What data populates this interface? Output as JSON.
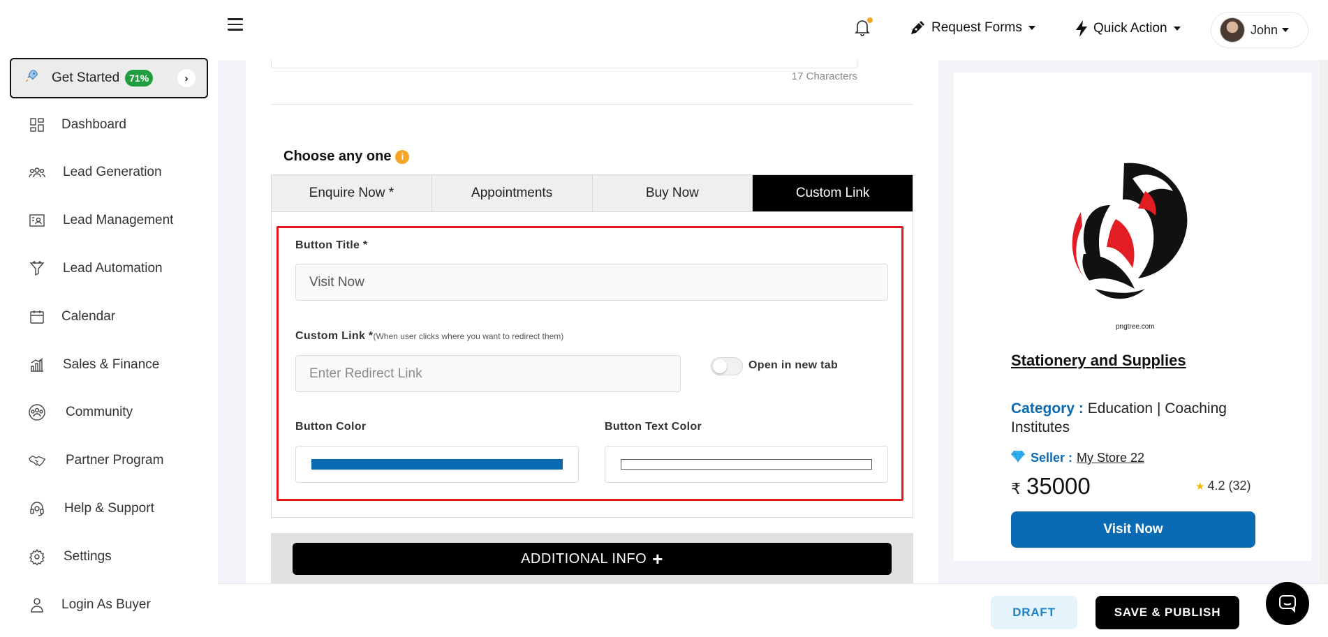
{
  "header": {
    "request_forms": "Request Forms",
    "quick_action": "Quick Action",
    "user_name": "John"
  },
  "sidebar": {
    "get_started": {
      "label": "Get Started",
      "progress": "71%"
    },
    "items": [
      {
        "label": "Dashboard",
        "icon": "dashboard-icon"
      },
      {
        "label": "Lead Generation",
        "icon": "users-icon"
      },
      {
        "label": "Lead Management",
        "icon": "contact-card-icon"
      },
      {
        "label": "Lead Automation",
        "icon": "funnel-icon"
      },
      {
        "label": "Calendar",
        "icon": "calendar-icon"
      },
      {
        "label": "Sales & Finance",
        "icon": "bar-chart-icon"
      },
      {
        "label": "Community",
        "icon": "community-icon"
      },
      {
        "label": "Partner Program",
        "icon": "handshake-icon"
      },
      {
        "label": "Help & Support",
        "icon": "headset-icon"
      },
      {
        "label": "Settings",
        "icon": "gear-icon"
      },
      {
        "label": "Login As Buyer",
        "icon": "person-icon"
      }
    ]
  },
  "form": {
    "char_count": "17 Characters",
    "choose_title": "Choose any one",
    "tabs": [
      "Enquire Now *",
      "Appointments",
      "Buy Now",
      "Custom Link"
    ],
    "active_tab": "Custom Link",
    "button_title_label": "Button Title *",
    "button_title_value": "Visit Now",
    "custom_link_label": "Custom Link *",
    "custom_link_hint": "(When user clicks where you want to redirect them)",
    "custom_link_placeholder": "Enter Redirect Link",
    "open_new_tab_label": "Open in new tab",
    "open_new_tab_on": false,
    "button_color_label": "Button Color",
    "button_color": "#0a6ab3",
    "button_text_color_label": "Button Text Color",
    "button_text_color": "#ffffff",
    "additional_info": "ADDITIONAL INFO"
  },
  "preview": {
    "logo_caption": "pngtree.com",
    "title": "Stationery and Supplies",
    "category_label": "Category :",
    "category_value": "Education | Coaching Institutes",
    "seller_label": "Seller :",
    "seller_value": "My Store 22",
    "currency": "₹",
    "price": "35000",
    "rating": "4.2 (32)",
    "button_label": "Visit Now"
  },
  "footer": {
    "draft": "DRAFT",
    "publish": "SAVE & PUBLISH"
  },
  "colors": {
    "accent_blue": "#0a6ab3",
    "highlight_red": "#e4161b",
    "progress_green": "#1f9d3f",
    "notification_orange": "#f4a52a"
  }
}
